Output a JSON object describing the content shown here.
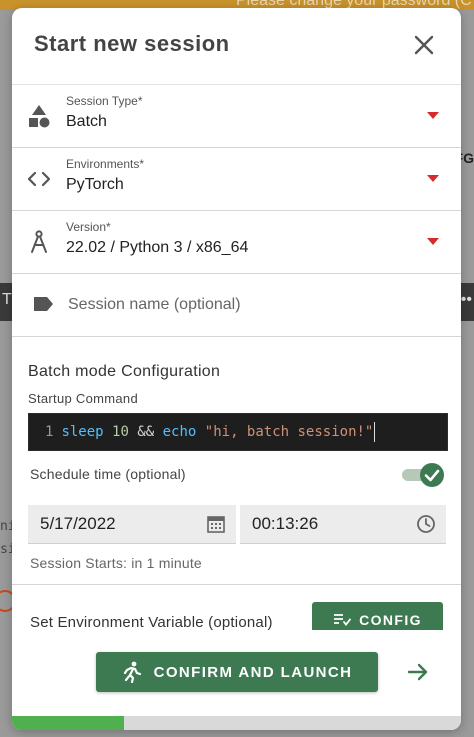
{
  "background": {
    "banner_text": "Please change your password (C",
    "strip_left": "T",
    "strip_right": "••",
    "side_right_text": "FG",
    "side_left_line1": "ni",
    "side_left_line2": "si"
  },
  "dialog": {
    "title": "Start new session",
    "close_icon": "close-icon",
    "session_type": {
      "label": "Session Type*",
      "value": "Batch",
      "icon": "shapes-icon"
    },
    "environments": {
      "label": "Environments*",
      "value": "PyTorch",
      "icon": "code-icon"
    },
    "version": {
      "label": "Version*",
      "value": "22.02 / Python 3 / x86_64",
      "icon": "compass-icon"
    },
    "session_name": {
      "placeholder": "Session name (optional)",
      "value": "",
      "icon": "label-icon"
    },
    "batch": {
      "section_title": "Batch mode Configuration",
      "startup_label": "Startup Command",
      "code": {
        "line_number": "1",
        "tokens": {
          "cmd": "sleep",
          "num": "10",
          "op": "&&",
          "cmd2": "echo",
          "str": "\"hi, batch session!\""
        }
      },
      "schedule_label": "Schedule time (optional)",
      "schedule_enabled": true,
      "date": "5/17/2022",
      "time": "00:13:26",
      "session_starts": "Session Starts: in 1 minute"
    },
    "env_var": {
      "label": "Set Environment Variable (optional)",
      "button": "CONFIG"
    },
    "confirm_button": "CONFIRM AND LAUNCH",
    "next_icon": "arrow-right-icon",
    "progress": 0.25
  },
  "colors": {
    "accent_green": "#3d7a52",
    "caret_red": "#d62b2b",
    "progress_green": "#50b04f",
    "banner": "#c9932c"
  }
}
